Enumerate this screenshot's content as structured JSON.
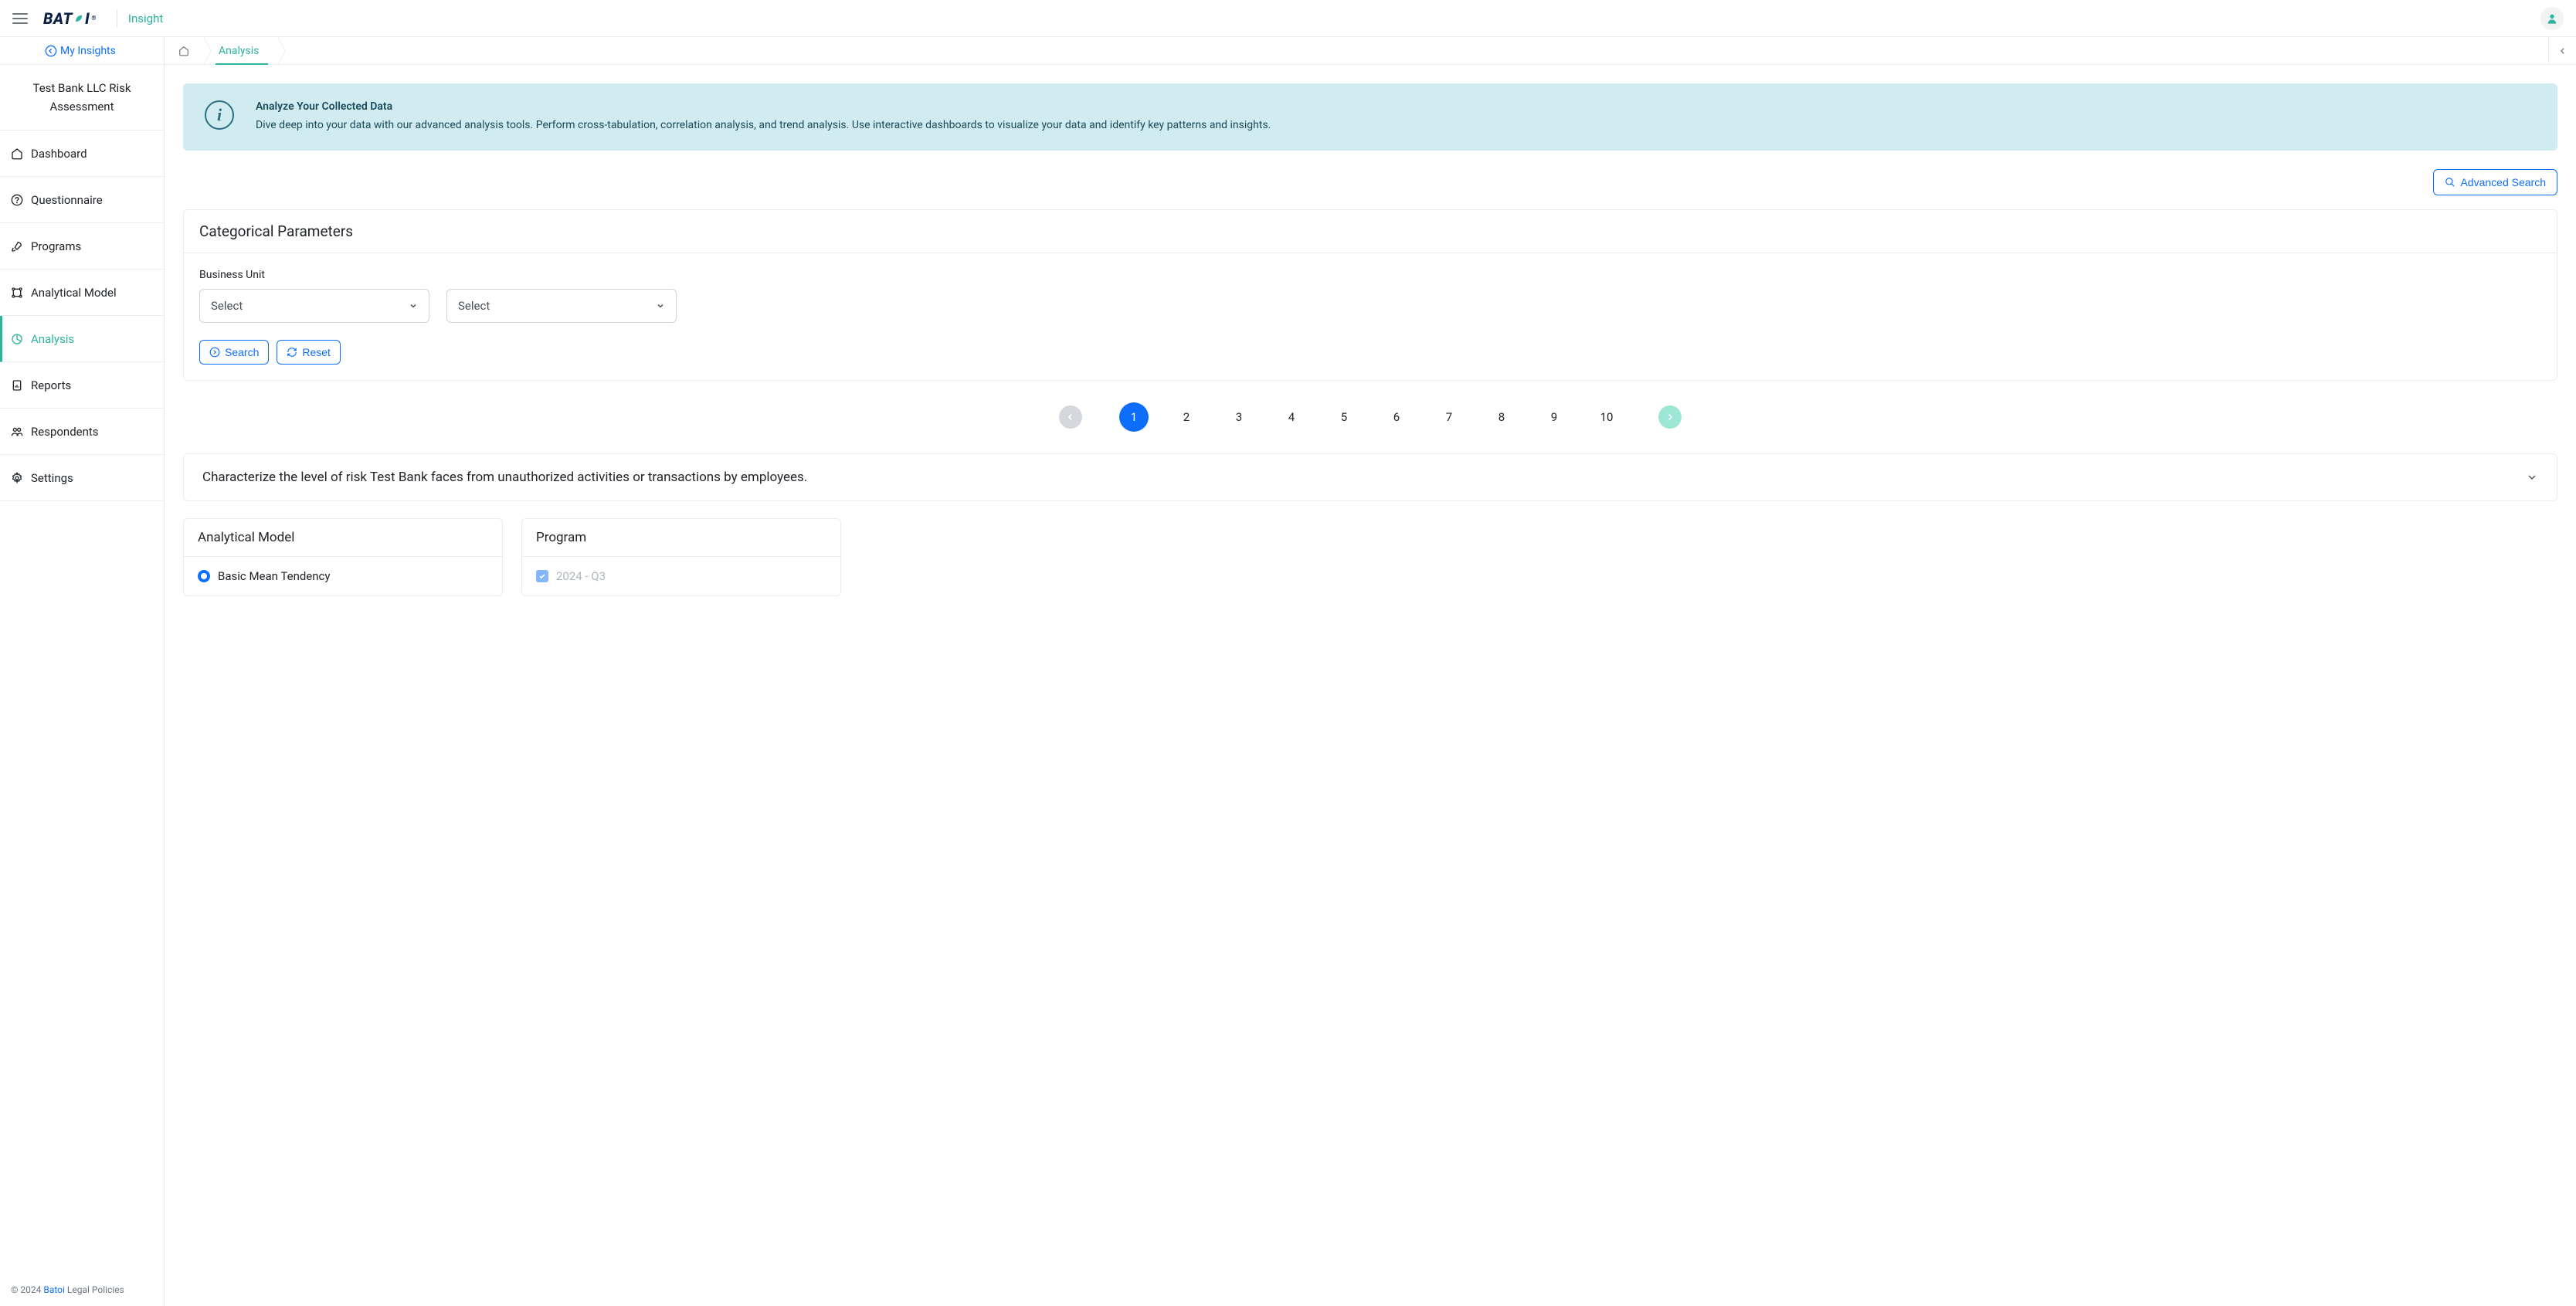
{
  "header": {
    "logo_text": "BATOI",
    "app_name": "Insight"
  },
  "sidebar": {
    "my_insights": "My Insights",
    "project_name": "Test Bank LLC Risk Assessment",
    "nav": [
      {
        "label": "Dashboard"
      },
      {
        "label": "Questionnaire"
      },
      {
        "label": "Programs"
      },
      {
        "label": "Analytical Model"
      },
      {
        "label": "Analysis"
      },
      {
        "label": "Reports"
      },
      {
        "label": "Respondents"
      },
      {
        "label": "Settings"
      }
    ],
    "footer_copyright": "© 2024 ",
    "footer_brand": "Batoi",
    "footer_legal": " Legal Policies"
  },
  "breadcrumb": {
    "current": "Analysis"
  },
  "banner": {
    "title": "Analyze Your Collected Data",
    "desc": "Dive deep into your data with our advanced analysis tools. Perform cross-tabulation, correlation analysis, and trend analysis. Use interactive dashboards to visualize your data and identify key patterns and insights."
  },
  "advanced_search_label": "Advanced Search",
  "categorical": {
    "title": "Categorical Parameters",
    "field_label": "Business Unit",
    "select1": "Select",
    "select2": "Select",
    "search_btn": "Search",
    "reset_btn": "Reset"
  },
  "pagination": {
    "pages": [
      "1",
      "2",
      "3",
      "4",
      "5",
      "6",
      "7",
      "8",
      "9",
      "10"
    ],
    "active": "1"
  },
  "accordion": {
    "title": "Characterize the level of risk Test Bank faces from unauthorized activities or transactions by employees."
  },
  "cards": {
    "analytical": {
      "title": "Analytical Model",
      "option": "Basic Mean Tendency"
    },
    "program": {
      "title": "Program",
      "option": "2024 - Q3"
    }
  }
}
